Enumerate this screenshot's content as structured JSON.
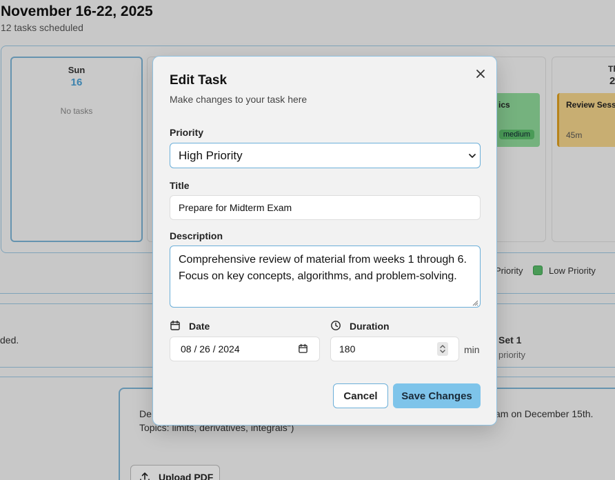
{
  "header": {
    "title": "November 16-22, 2025",
    "subtitle": "12 tasks scheduled"
  },
  "calendar": {
    "days": [
      {
        "name": "Sun",
        "date": "16",
        "empty_text": "No tasks"
      }
    ],
    "thu_label": "Th",
    "thu_date": "2",
    "tasks": [
      {
        "title": "ics",
        "badge": "medium",
        "color": "#8fd99a"
      },
      {
        "title": "Review Sess",
        "duration": "45m",
        "color": "#f5d58b"
      }
    ],
    "legend": {
      "partial": "Priority",
      "low": "Low Priority"
    }
  },
  "background": {
    "text_left": "ded.",
    "set_title": "Set 1",
    "set_sub": "priority",
    "desc_left": "De",
    "desc_right": "am on December 15th.",
    "topics": "Topics: limits, derivatives, integrals\")",
    "upload_label": "Upload PDF"
  },
  "modal": {
    "title": "Edit Task",
    "subtitle": "Make changes to your task here",
    "priority_label": "Priority",
    "priority_value": "High Priority",
    "title_label": "Title",
    "title_value": "Prepare for Midterm Exam",
    "description_label": "Description",
    "description_value": "Comprehensive review of material from weeks 1 through 6. Focus on key concepts, algorithms, and problem-solving.",
    "date_label": "Date",
    "date_value": "08 / 26 / 2024",
    "duration_label": "Duration",
    "duration_value": "180",
    "duration_unit": "min",
    "cancel_label": "Cancel",
    "save_label": "Save Changes"
  },
  "colors": {
    "accent": "#7ec4ea",
    "border_accent": "#6aaed8",
    "date_blue": "#4a9fd4"
  }
}
